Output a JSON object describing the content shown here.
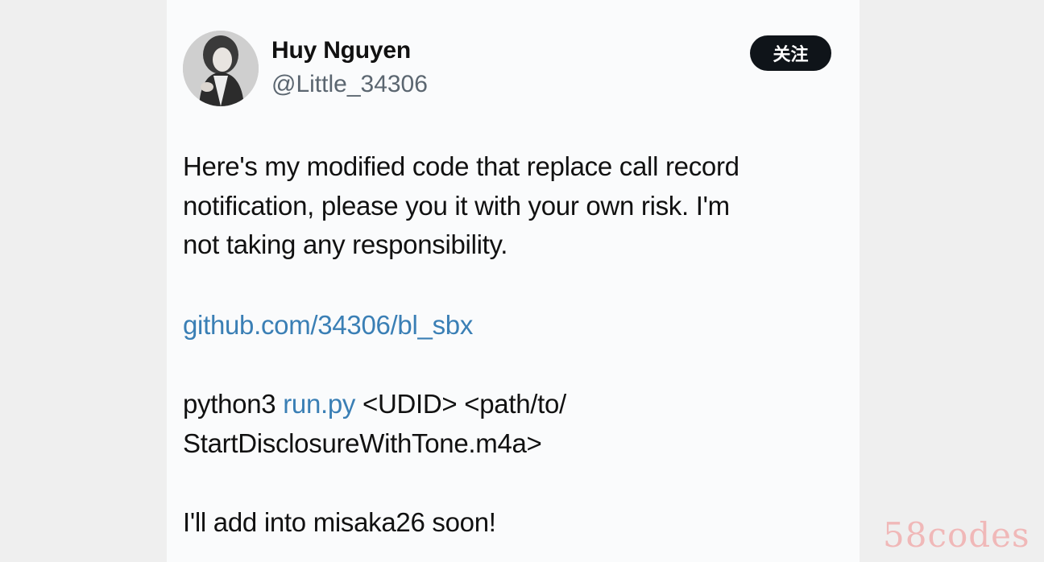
{
  "author": {
    "display_name": "Huy Nguyen",
    "handle": "@Little_34306",
    "avatar_icon": "profile-photo"
  },
  "follow_button": {
    "label": "关注"
  },
  "tweet": {
    "line1": "Here's my modified code that replace call record",
    "line2": "notification, please you it with your own risk. I'm",
    "line3": "not taking any responsibility.",
    "link_url_text": "github.com/34306/bl_sbx",
    "command_prefix": "python3 ",
    "command_link": "run.py",
    "command_suffix": " <UDID> <path/to/",
    "command_line2": "StartDisclosureWithTone.m4a>",
    "closing": "I'll add into misaka26 soon!"
  },
  "watermark": "58codes",
  "colors": {
    "link": "#3a7fb5",
    "button_bg": "#0f1419",
    "handle": "#5b6670"
  }
}
